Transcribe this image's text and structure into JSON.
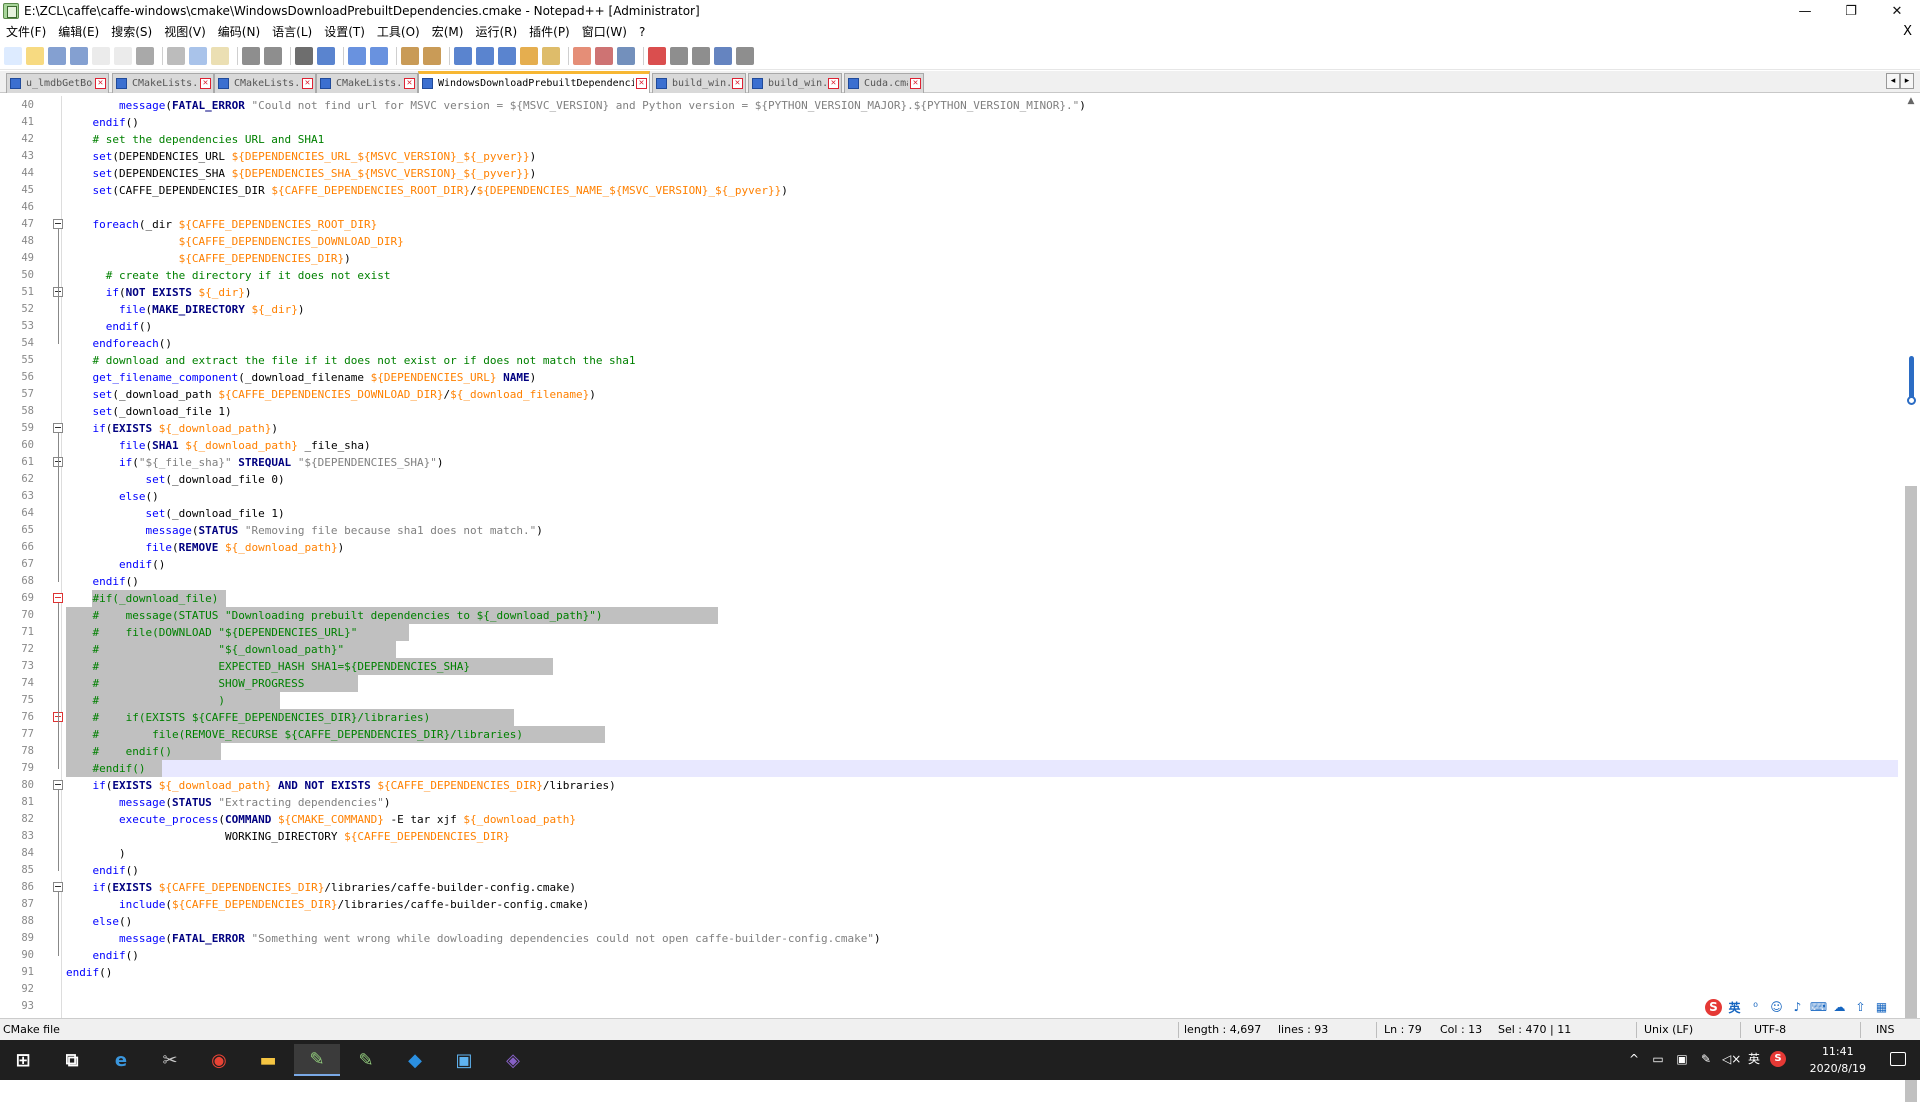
{
  "window": {
    "title": "E:\\ZCL\\caffe\\caffe-windows\\cmake\\WindowsDownloadPrebuiltDependencies.cmake - Notepad++ [Administrator]",
    "controls": [
      "—",
      "❐",
      "✕"
    ]
  },
  "menu": {
    "items": [
      "文件(F)",
      "编辑(E)",
      "搜索(S)",
      "视图(V)",
      "编码(N)",
      "语言(L)",
      "设置(T)",
      "工具(O)",
      "宏(M)",
      "运行(R)",
      "插件(P)",
      "窗口(W)",
      "?"
    ],
    "close": "X"
  },
  "toolbar": {
    "icons": [
      "new-icon",
      "open-icon",
      "save-icon",
      "save-all-icon",
      "close-icon",
      "close-all-icon",
      "print-icon",
      "cut-icon",
      "copy-icon",
      "paste-icon",
      "undo-icon",
      "redo-icon",
      "find-icon",
      "replace-icon",
      "zoom-in-icon",
      "zoom-out-icon",
      "sync-v-icon",
      "sync-h-icon",
      "word-wrap-icon",
      "show-all-chars-icon",
      "indent-guide-icon",
      "doc-map-icon",
      "function-list-icon",
      "folder-as-workspace-icon",
      "monitoring-icon",
      "eye-icon",
      "record-macro-icon",
      "stop-macro-icon",
      "play-macro-icon",
      "run-macro-multiple-icon",
      "save-macro-icon"
    ]
  },
  "tabs": [
    {
      "label": "u_lmdbGetBody.sh",
      "active": false
    },
    {
      "label": "CMakeLists.txt",
      "active": false
    },
    {
      "label": "CMakeLists.txt",
      "active": false
    },
    {
      "label": "CMakeLists.txt",
      "active": false
    },
    {
      "label": "WindowsDownloadPrebuiltDependencies.cmake",
      "active": true
    },
    {
      "label": "build_win.cmd",
      "active": false
    },
    {
      "label": "build_win.cmd",
      "active": false
    },
    {
      "label": "Cuda.cmake",
      "active": false
    }
  ],
  "tab_scroll": [
    "◂",
    "▸"
  ],
  "editor": {
    "first_line": 40,
    "current_line": 79,
    "lines": [
      {
        "n": 40,
        "t": "        message(FATAL_ERROR \"Could not find url for MSVC version = ${MSVC_VERSION} and Python version = ${PYTHON_VERSION_MAJOR}.${PYTHON_VERSION_MINOR}.\")"
      },
      {
        "n": 41,
        "t": "    endif()"
      },
      {
        "n": 42,
        "t": "    # set the dependencies URL and SHA1"
      },
      {
        "n": 43,
        "t": "    set(DEPENDENCIES_URL ${DEPENDENCIES_URL_${MSVC_VERSION}_${_pyver}})"
      },
      {
        "n": 44,
        "t": "    set(DEPENDENCIES_SHA ${DEPENDENCIES_SHA_${MSVC_VERSION}_${_pyver}})"
      },
      {
        "n": 45,
        "t": "    set(CAFFE_DEPENDENCIES_DIR ${CAFFE_DEPENDENCIES_ROOT_DIR}/${DEPENDENCIES_NAME_${MSVC_VERSION}_${_pyver}})"
      },
      {
        "n": 46,
        "t": ""
      },
      {
        "n": 47,
        "t": "    foreach(_dir ${CAFFE_DEPENDENCIES_ROOT_DIR}"
      },
      {
        "n": 48,
        "t": "                 ${CAFFE_DEPENDENCIES_DOWNLOAD_DIR}"
      },
      {
        "n": 49,
        "t": "                 ${CAFFE_DEPENDENCIES_DIR})"
      },
      {
        "n": 50,
        "t": "      # create the directory if it does not exist"
      },
      {
        "n": 51,
        "t": "      if(NOT EXISTS ${_dir})"
      },
      {
        "n": 52,
        "t": "        file(MAKE_DIRECTORY ${_dir})"
      },
      {
        "n": 53,
        "t": "      endif()"
      },
      {
        "n": 54,
        "t": "    endforeach()"
      },
      {
        "n": 55,
        "t": "    # download and extract the file if it does not exist or if does not match the sha1"
      },
      {
        "n": 56,
        "t": "    get_filename_component(_download_filename ${DEPENDENCIES_URL} NAME)"
      },
      {
        "n": 57,
        "t": "    set(_download_path ${CAFFE_DEPENDENCIES_DOWNLOAD_DIR}/${_download_filename})"
      },
      {
        "n": 58,
        "t": "    set(_download_file 1)"
      },
      {
        "n": 59,
        "t": "    if(EXISTS ${_download_path})"
      },
      {
        "n": 60,
        "t": "        file(SHA1 ${_download_path} _file_sha)"
      },
      {
        "n": 61,
        "t": "        if(\"${_file_sha}\" STREQUAL \"${DEPENDENCIES_SHA}\")"
      },
      {
        "n": 62,
        "t": "            set(_download_file 0)"
      },
      {
        "n": 63,
        "t": "        else()"
      },
      {
        "n": 64,
        "t": "            set(_download_file 1)"
      },
      {
        "n": 65,
        "t": "            message(STATUS \"Removing file because sha1 does not match.\")"
      },
      {
        "n": 66,
        "t": "            file(REMOVE ${_download_path})"
      },
      {
        "n": 67,
        "t": "        endif()"
      },
      {
        "n": 68,
        "t": "    endif()"
      },
      {
        "n": 69,
        "t": "    #if(_download_file)"
      },
      {
        "n": 70,
        "t": "    #    message(STATUS \"Downloading prebuilt dependencies to ${_download_path}\")"
      },
      {
        "n": 71,
        "t": "    #    file(DOWNLOAD \"${DEPENDENCIES_URL}\""
      },
      {
        "n": 72,
        "t": "    #                  \"${_download_path}\""
      },
      {
        "n": 73,
        "t": "    #                  EXPECTED_HASH SHA1=${DEPENDENCIES_SHA}"
      },
      {
        "n": 74,
        "t": "    #                  SHOW_PROGRESS"
      },
      {
        "n": 75,
        "t": "    #                  )"
      },
      {
        "n": 76,
        "t": "    #    if(EXISTS ${CAFFE_DEPENDENCIES_DIR}/libraries)"
      },
      {
        "n": 77,
        "t": "    #        file(REMOVE_RECURSE ${CAFFE_DEPENDENCIES_DIR}/libraries)"
      },
      {
        "n": 78,
        "t": "    #    endif()"
      },
      {
        "n": 79,
        "t": "    #endif()"
      },
      {
        "n": 80,
        "t": "    if(EXISTS ${_download_path} AND NOT EXISTS ${CAFFE_DEPENDENCIES_DIR}/libraries)"
      },
      {
        "n": 81,
        "t": "        message(STATUS \"Extracting dependencies\")"
      },
      {
        "n": 82,
        "t": "        execute_process(COMMAND ${CMAKE_COMMAND} -E tar xjf ${_download_path}"
      },
      {
        "n": 83,
        "t": "                        WORKING_DIRECTORY ${CAFFE_DEPENDENCIES_DIR}"
      },
      {
        "n": 84,
        "t": "        )"
      },
      {
        "n": 85,
        "t": "    endif()"
      },
      {
        "n": 86,
        "t": "    if(EXISTS ${CAFFE_DEPENDENCIES_DIR}/libraries/caffe-builder-config.cmake)"
      },
      {
        "n": 87,
        "t": "        include(${CAFFE_DEPENDENCIES_DIR}/libraries/caffe-builder-config.cmake)"
      },
      {
        "n": 88,
        "t": "    else()"
      },
      {
        "n": 89,
        "t": "        message(FATAL_ERROR \"Something went wrong while dowloading dependencies could not open caffe-builder-config.cmake\")"
      },
      {
        "n": 90,
        "t": "    endif()"
      },
      {
        "n": 91,
        "t": "endif()"
      },
      {
        "n": 92,
        "t": ""
      },
      {
        "n": 93,
        "t": ""
      }
    ]
  },
  "colors": {
    "keyword": "#0000ff",
    "bold_keyword": "#000080",
    "string": "#808080",
    "variable": "#ff8000",
    "comment": "#008000",
    "selection": "#c0c0c0",
    "caret_line": "#e8e8ff"
  },
  "statusbar": {
    "lang": "CMake file",
    "length": "length : 4,697",
    "lines": "lines : 93",
    "ln": "Ln : 79",
    "col": "Col : 13",
    "sel": "Sel : 470 | 11",
    "eol": "Unix (LF)",
    "encoding": "UTF-8",
    "mode": "INS"
  },
  "ime": {
    "logo": "S",
    "lang": "英",
    "icons": [
      "punctuation-icon",
      "emoji-icon",
      "mic-icon",
      "keyboard-icon",
      "skin-icon",
      "upload-icon",
      "toolbox-icon"
    ]
  },
  "taskbar": {
    "apps": [
      "start-icon",
      "task-view-icon",
      "edge-icon",
      "snipping-icon",
      "chrome-icon",
      "file-explorer-icon",
      "notepadpp-icon",
      "notepadpp-2-icon",
      "vscode-icon",
      "remote-desktop-icon",
      "visual-studio-icon"
    ],
    "clock_time": "11:41",
    "clock_date": "2020/8/19",
    "input_lang": "英"
  }
}
